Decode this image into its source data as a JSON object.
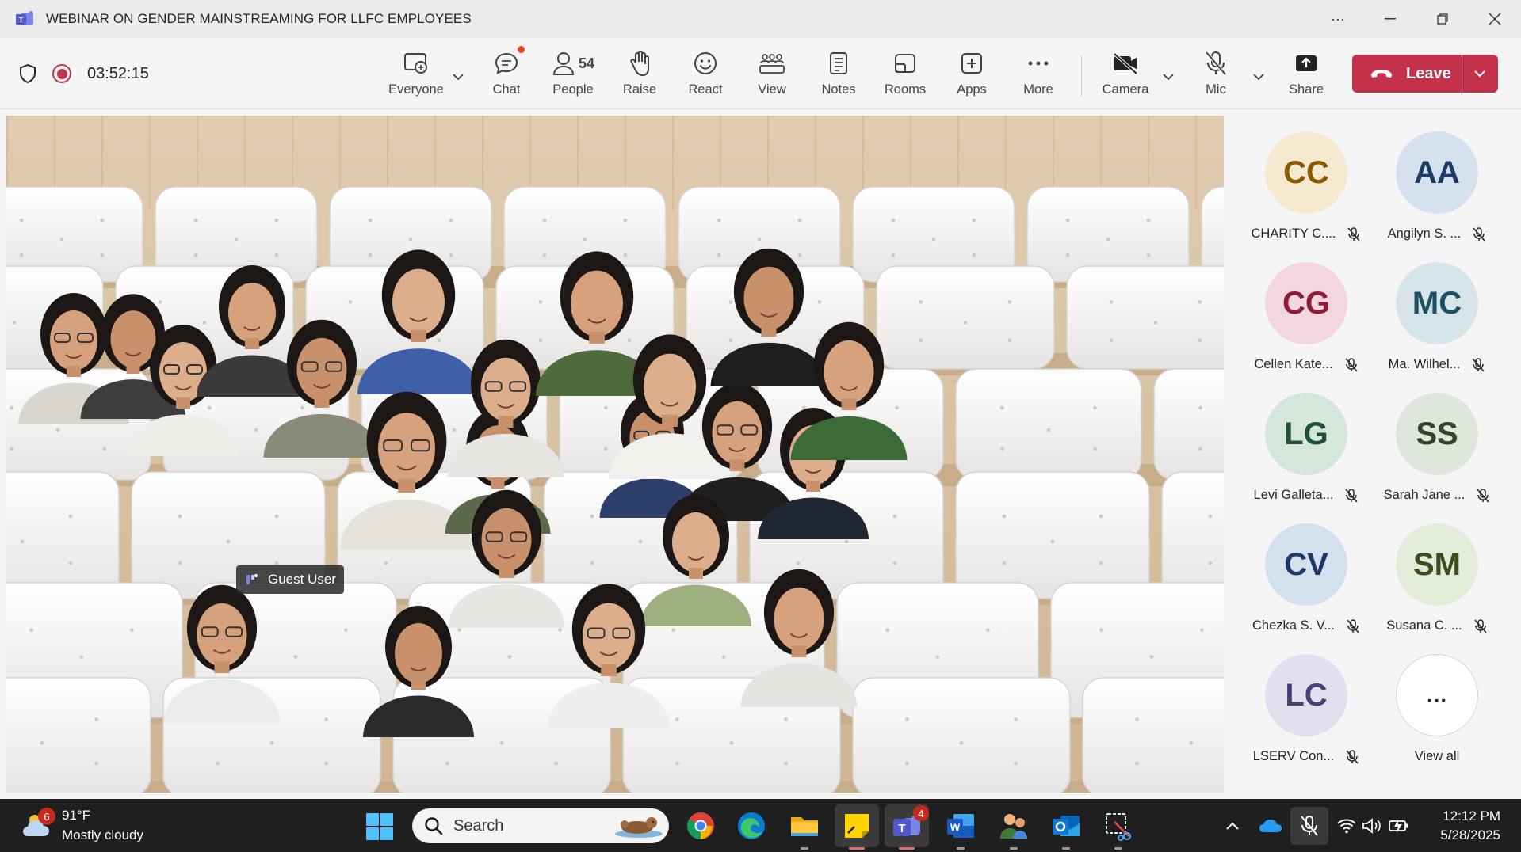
{
  "window": {
    "title": "WEBINAR ON GENDER MAINSTREAMING FOR LLFC EMPLOYEES"
  },
  "toolbar": {
    "timer": "03:52:15",
    "everyone_label": "Everyone",
    "chat_label": "Chat",
    "people_label": "People",
    "people_count": "54",
    "raise_label": "Raise",
    "react_label": "React",
    "view_label": "View",
    "notes_label": "Notes",
    "rooms_label": "Rooms",
    "apps_label": "Apps",
    "more_label": "More",
    "camera_label": "Camera",
    "mic_label": "Mic",
    "share_label": "Share",
    "leave_label": "Leave"
  },
  "stage": {
    "guest_label": "Guest User"
  },
  "participants": [
    {
      "initials": "CC",
      "name": "CHARITY C....",
      "bg": "#f5ead0",
      "fg": "#8a5a00"
    },
    {
      "initials": "AA",
      "name": "Angilyn S. ...",
      "bg": "#d6e1f0",
      "fg": "#1c3a66"
    },
    {
      "initials": "CG",
      "name": "Cellen Kate...",
      "bg": "#f4d6de",
      "fg": "#8f1a3b"
    },
    {
      "initials": "MC",
      "name": "Ma. Wilhel...",
      "bg": "#d7e4ea",
      "fg": "#1d4f63"
    },
    {
      "initials": "LG",
      "name": "Levi Galleta...",
      "bg": "#d5e7dd",
      "fg": "#1d5235"
    },
    {
      "initials": "SS",
      "name": "Sarah Jane ...",
      "bg": "#dfe6dc",
      "fg": "#35452a"
    },
    {
      "initials": "CV",
      "name": "Chezka S. V...",
      "bg": "#d5e0ef",
      "fg": "#1c3a66"
    },
    {
      "initials": "SM",
      "name": "Susana C. ...",
      "bg": "#e3ebd9",
      "fg": "#3a4f1d"
    },
    {
      "initials": "LC",
      "name": "LSERV Con...",
      "bg": "#e3dfee",
      "fg": "#4a3f73"
    }
  ],
  "view_all": {
    "label": "View all",
    "icon": "..."
  },
  "taskbar": {
    "weather_badge": "6",
    "temperature": "91°F",
    "condition": "Mostly cloudy",
    "search_label": "Search",
    "teams_badge": "4",
    "time": "12:12 PM",
    "date": "5/28/2025"
  },
  "colors": {
    "accent_red": "#c4314b",
    "teams_purple": "#5b5fc7",
    "taskbar": "#1f1f1f"
  }
}
